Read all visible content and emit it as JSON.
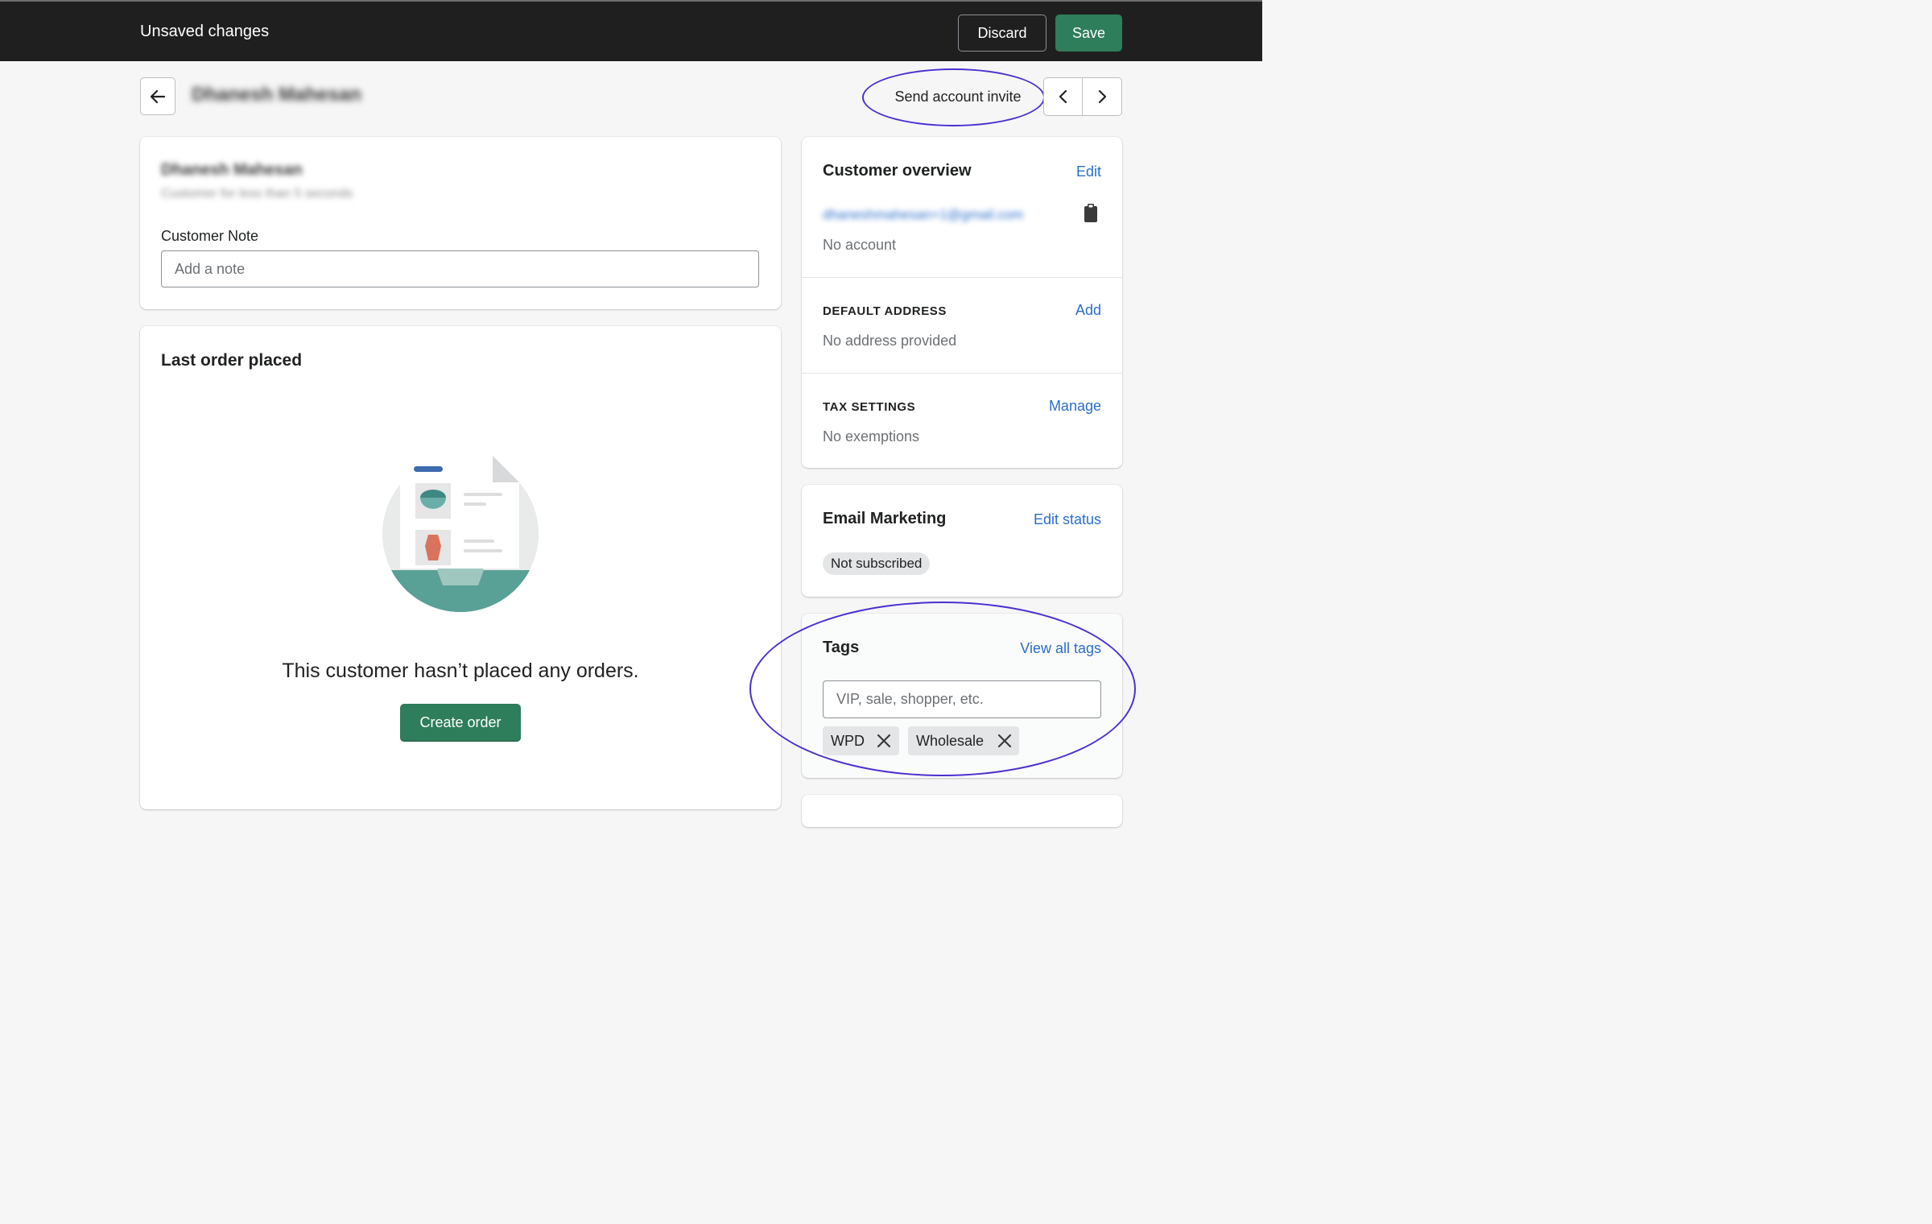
{
  "topbar": {
    "title": "Unsaved changes",
    "discard_label": "Discard",
    "save_label": "Save"
  },
  "header": {
    "customer_name": "Dhanesh Mahesan",
    "send_invite_label": "Send account invite"
  },
  "summary_card": {
    "customer_name": "Dhanesh Mahesan",
    "customer_since": "Customer for less than 5 seconds",
    "note_label": "Customer Note",
    "note_placeholder": "Add a note"
  },
  "orders_card": {
    "title": "Last order placed",
    "empty_message": "This customer hasn’t placed any orders.",
    "create_order_label": "Create order"
  },
  "overview_card": {
    "title": "Customer overview",
    "edit_label": "Edit",
    "email": "dhaneshmahesan+1@gmail.com",
    "account_status": "No account",
    "default_address_heading": "DEFAULT ADDRESS",
    "address_add_label": "Add",
    "address_value": "No address provided",
    "tax_heading": "TAX SETTINGS",
    "tax_manage_label": "Manage",
    "tax_value": "No exemptions"
  },
  "email_marketing_card": {
    "title": "Email Marketing",
    "edit_status_label": "Edit status",
    "status_badge": "Not subscribed"
  },
  "tags_card": {
    "title": "Tags",
    "view_all_label": "View all tags",
    "input_placeholder": "VIP, sale, shopper, etc.",
    "tags": [
      "WPD",
      "Wholesale"
    ]
  },
  "colors": {
    "primary_green": "#2e7d5b",
    "link_blue": "#2c6ecb",
    "annotation_purple": "#4d2fd0",
    "topbar_bg": "#1f1f1f"
  }
}
